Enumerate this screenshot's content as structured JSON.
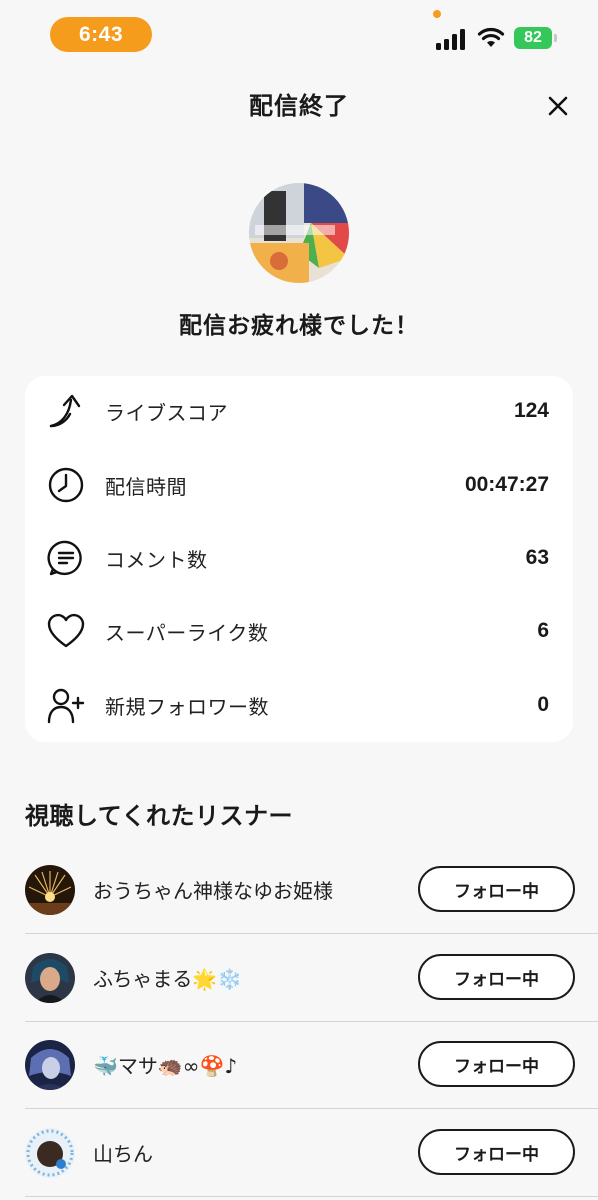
{
  "status_bar": {
    "time": "6:43",
    "battery": "82"
  },
  "header": {
    "title": "配信終了",
    "close_icon": "close-icon"
  },
  "hero": {
    "message": "配信お疲れ様でした！"
  },
  "stats": [
    {
      "icon": "rising-arrow-icon",
      "label": "ライブスコア",
      "value": "124"
    },
    {
      "icon": "clock-icon",
      "label": "配信時間",
      "value": "00:47:27"
    },
    {
      "icon": "comment-icon",
      "label": "コメント数",
      "value": "63"
    },
    {
      "icon": "heart-icon",
      "label": "スーパーライク数",
      "value": "6"
    },
    {
      "icon": "add-user-icon",
      "label": "新規フォロワー数",
      "value": "0"
    }
  ],
  "listeners_section": {
    "title": "視聴してくれたリスナー",
    "listeners": [
      {
        "name": "おうちゃん神様なゆお姫様",
        "button": "フォロー中"
      },
      {
        "name": "ふちゃまる🌟❄️",
        "button": "フォロー中"
      },
      {
        "name": "🐳マサ🦔∞🍄♪",
        "button": "フォロー中"
      },
      {
        "name": "山ちん",
        "button": "フォロー中"
      }
    ]
  },
  "colors": {
    "accent": "#f59c1d",
    "battery": "#34c759",
    "background": "#f7f7f7",
    "card": "#ffffff"
  }
}
